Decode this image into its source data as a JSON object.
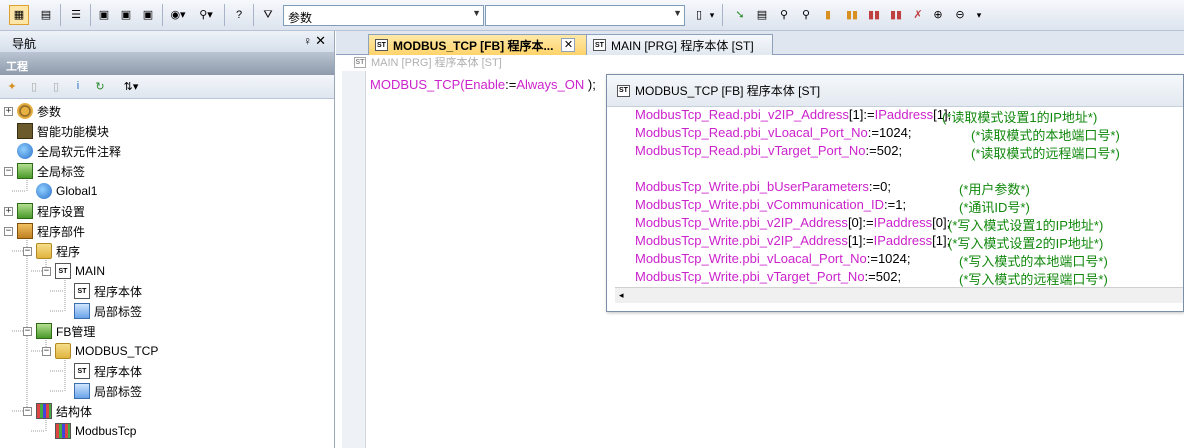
{
  "toolbar": {
    "search_value": "参数",
    "buttons": [
      "project-icon",
      "memory-icon",
      "list-icon",
      "dev-icon",
      "dev2-icon",
      "dev3-icon",
      "monitor-icon",
      "zoom-icon",
      "help-icon",
      "binoculars-icon"
    ],
    "right_buttons": [
      "run-icon",
      "doc-icon",
      "search1-icon",
      "search2-icon",
      "var-icon",
      "chart1-icon",
      "chart2-icon",
      "chart3-icon",
      "chart4-icon",
      "zoom-in-icon",
      "zoom-out-icon"
    ]
  },
  "nav": {
    "title": "导航",
    "pin": "♀",
    "close": "✕",
    "project_label": "工程",
    "tree": [
      {
        "label": "参数",
        "level": 0,
        "exp": "+",
        "icon": "gear"
      },
      {
        "label": "智能功能模块",
        "level": 0,
        "exp": "",
        "icon": "chip"
      },
      {
        "label": "全局软元件注释",
        "level": 0,
        "exp": "",
        "icon": "globe"
      },
      {
        "label": "全局标签",
        "level": 0,
        "exp": "−",
        "icon": "book"
      },
      {
        "label": "Global1",
        "level": 1,
        "exp": "",
        "icon": "globe"
      },
      {
        "label": "程序设置",
        "level": 0,
        "exp": "+",
        "icon": "book"
      },
      {
        "label": "程序部件",
        "level": 0,
        "exp": "−",
        "icon": "pkg"
      },
      {
        "label": "程序",
        "level": 1,
        "exp": "−",
        "icon": "folder"
      },
      {
        "label": "MAIN",
        "level": 2,
        "exp": "−",
        "icon": "st"
      },
      {
        "label": "程序本体",
        "level": 3,
        "exp": "",
        "icon": "st"
      },
      {
        "label": "局部标签",
        "level": 3,
        "exp": "",
        "icon": "local"
      },
      {
        "label": "FB管理",
        "level": 1,
        "exp": "−",
        "icon": "book"
      },
      {
        "label": "MODBUS_TCP",
        "level": 2,
        "exp": "−",
        "icon": "folder"
      },
      {
        "label": "程序本体",
        "level": 3,
        "exp": "",
        "icon": "st"
      },
      {
        "label": "局部标签",
        "level": 3,
        "exp": "",
        "icon": "local"
      },
      {
        "label": "结构体",
        "level": 1,
        "exp": "−",
        "icon": "struct"
      },
      {
        "label": "ModbusTcp",
        "level": 2,
        "exp": "",
        "icon": "struct"
      }
    ]
  },
  "tabs": [
    {
      "label": "MODBUS_TCP [FB] 程序本...",
      "active": true,
      "close": "✕"
    },
    {
      "label": "MAIN [PRG] 程序本体 [ST]",
      "active": false
    }
  ],
  "editor": {
    "header": "MAIN [PRG] 程序本体 [ST]",
    "code": {
      "fn": "MODBUS_TCP",
      "p1": "(",
      "arg": "Enable",
      "p2": ":=",
      "val": "Always_ON",
      "p3": " );"
    }
  },
  "popup": {
    "title": "MODBUS_TCP [FB] 程序本体 [ST]",
    "lines": [
      {
        "var": "ModbusTcp_Read.pbi_v2IP_Address",
        "idx": "[1]",
        "op": ":=",
        "rhs": "IPaddress",
        "rhs_idx": "[1];",
        "comment": " (*读取模式设置1的IP地址*)"
      },
      {
        "var": "ModbusTcp_Read.pbi_vLoacal_Port_No",
        "idx": "",
        "op": ":=",
        "rhs": "",
        "rhs_idx": "1024;",
        "comment": "(*读取模式的本地端口号*)"
      },
      {
        "var": "ModbusTcp_Read.pbi_vTarget_Port_No",
        "idx": "",
        "op": ":=",
        "rhs": "",
        "rhs_idx": "502;",
        "comment": "(*读取模式的远程端口号*)"
      },
      {
        "var": "ModbusTcp_Write.pbi_bUserParameters",
        "idx": "",
        "op": ":=",
        "rhs": "",
        "rhs_idx": "0;",
        "comment": "(*用户参数*)"
      },
      {
        "var": "ModbusTcp_Write.pbi_vCommunication_ID",
        "idx": "",
        "op": ":=",
        "rhs": "",
        "rhs_idx": "1;",
        "comment": "(*通讯ID号*)"
      },
      {
        "var": "ModbusTcp_Write.pbi_v2IP_Address",
        "idx": "[0]",
        "op": ":=",
        "rhs": "IPaddress",
        "rhs_idx": "[0];",
        "comment": "(*写入模式设置1的IP地址*)"
      },
      {
        "var": "ModbusTcp_Write.pbi_v2IP_Address",
        "idx": "[1]",
        "op": ":=",
        "rhs": "IPaddress",
        "rhs_idx": "[1];",
        "comment": "(*写入模式设置2的IP地址*)"
      },
      {
        "var": "ModbusTcp_Write.pbi_vLoacal_Port_No",
        "idx": "",
        "op": ":=",
        "rhs": "",
        "rhs_idx": "1024;",
        "comment": "(*写入模式的本地端口号*)"
      },
      {
        "var": "ModbusTcp_Write.pbi_vTarget_Port_No",
        "idx": "",
        "op": ":=",
        "rhs": "",
        "rhs_idx": "502;",
        "comment": "(*写入模式的远程端口号*)"
      }
    ],
    "scroll_arrow": "◂"
  },
  "colors": {
    "keyword": "#cc22cc",
    "comment": "#11880c",
    "tab_active": "#ffd36a"
  }
}
